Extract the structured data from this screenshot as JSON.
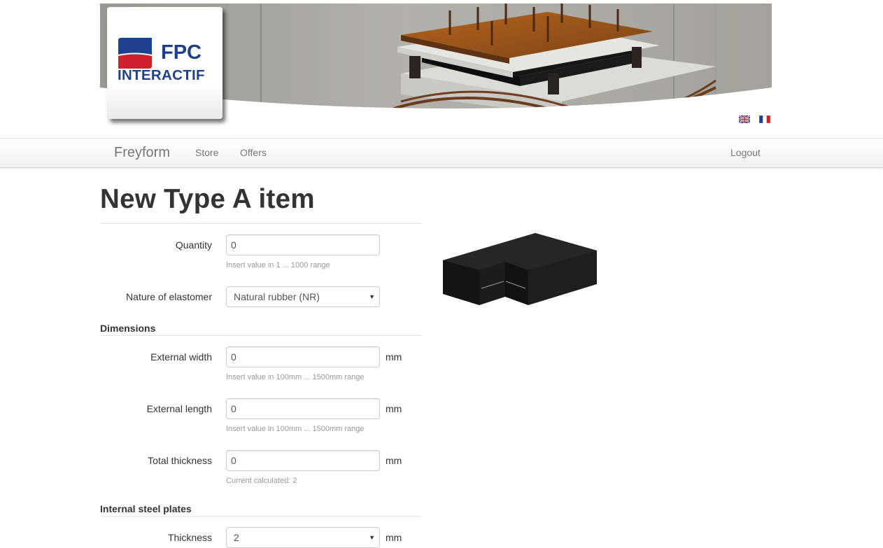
{
  "header": {
    "logo_top": "FPC",
    "logo_bottom": "INTERACTIF",
    "languages": [
      "English",
      "Français"
    ]
  },
  "navbar": {
    "brand": "Freyform",
    "links": [
      "Store",
      "Offers"
    ],
    "logout": "Logout"
  },
  "page": {
    "title": "New Type A item"
  },
  "form": {
    "quantity": {
      "label": "Quantity",
      "value": "0",
      "help": "Insert value in 1 ... 1000 range"
    },
    "elastomer": {
      "label": "Nature of elastomer",
      "value": "Natural rubber (NR)"
    },
    "dimensions": {
      "title": "Dimensions",
      "width": {
        "label": "External width",
        "value": "0",
        "unit": "mm",
        "help": "Insert value in 100mm ... 1500mm range"
      },
      "length": {
        "label": "External length",
        "value": "0",
        "unit": "mm",
        "help": "Insert value in 100mm ... 1500mm range"
      },
      "thickness": {
        "label": "Total thickness",
        "value": "0",
        "unit": "mm",
        "help": "Current calculated: 2"
      }
    },
    "plates": {
      "title": "Internal steel plates",
      "thickness": {
        "label": "Thickness",
        "value": "2",
        "unit": "mm"
      }
    }
  },
  "colors": {
    "brand_blue": "#1f3f8f",
    "brand_red": "#d0202e",
    "product": "#1e1e1e"
  }
}
